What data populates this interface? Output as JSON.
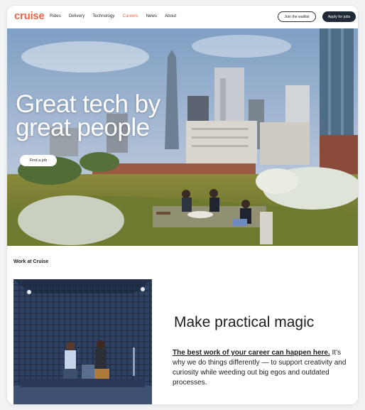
{
  "nav": {
    "logo": "cruise",
    "links": [
      "Rides",
      "Delivery",
      "Technology",
      "Careers",
      "News",
      "About"
    ],
    "active_link": "Careers",
    "join_button": "Join the waitlist",
    "apply_button": "Apply for jobs"
  },
  "hero": {
    "title_line1": "Great tech by",
    "title_line2": "great people",
    "cta": "Find a job"
  },
  "work": {
    "section_label": "Work at Cruise",
    "heading": "Make practical magic",
    "body_link": "The best work of your career can happen here.",
    "body_text": " It’s why we do things differently — to support creativity and curiosity while weeding out big egos and outdated processes."
  },
  "colors": {
    "brand": "#f2664a",
    "dark_button": "#1e2a35"
  }
}
